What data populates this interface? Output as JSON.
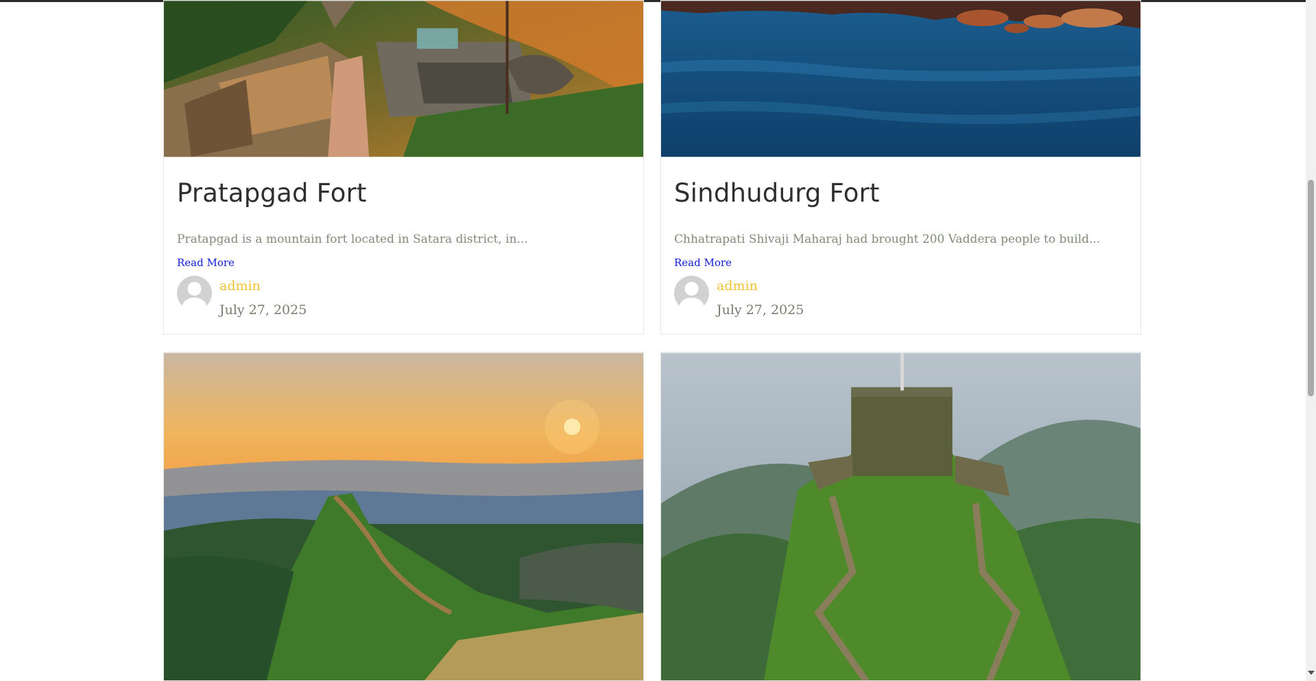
{
  "posts": [
    {
      "title": "Pratapgad Fort",
      "excerpt": "Pratapgad is a mountain fort located in Satara district, in...",
      "read_more": "Read More",
      "author": "admin",
      "date": "July 27, 2025",
      "image_alt": "Pratapgad fort walls on a green hillside"
    },
    {
      "title": "Sindhudurg Fort",
      "excerpt": "Chhatrapati Shivaji Maharaj had brought 200 Vaddera people to build...",
      "read_more": "Read More",
      "author": "admin",
      "date": "July 27, 2025",
      "image_alt": "Blue sea water with rocks near Sindhudurg fort"
    },
    {
      "image_alt": "Fort ridge at sunset over mountains"
    },
    {
      "image_alt": "Hilltop fort with zigzag stone walls and greenery"
    }
  ],
  "colors": {
    "title": "#2f2f2f",
    "excerpt": "#7f8b78",
    "read_more": "#1220d8",
    "author": "#f1c232",
    "date": "#7a7a6e",
    "card_border": "#e6e6e6"
  },
  "icons": {
    "avatar": "default-user-avatar-icon",
    "scroll_down": "scroll-down-arrow-icon"
  }
}
